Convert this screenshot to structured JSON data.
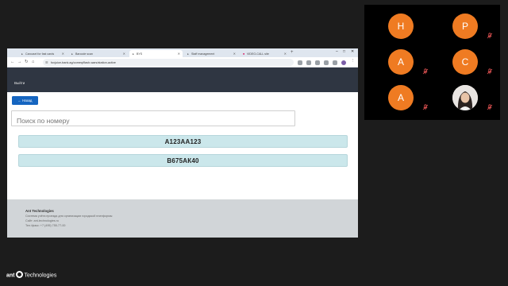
{
  "browser": {
    "tabs": [
      {
        "label": "Carousel for fast cards",
        "active": false
      },
      {
        "label": "Barcode scan",
        "active": false
      },
      {
        "label": "BYS",
        "active": true
      },
      {
        "label": "Staff management",
        "active": false
      },
      {
        "label": "VIDEO-CALL site",
        "active": false
      }
    ],
    "url": "foxjuice-bank.ag/comeq/flash-wars/station-active"
  },
  "app": {
    "exit_label": "Выйти",
    "back_label": "← Назад",
    "search_placeholder": "Поиск по номеру",
    "plates": [
      "А123АА123",
      "В675АК40"
    ],
    "footer": {
      "company": "Ant Technologies",
      "lines": [
        "Система учёта проезда для организации городской платформы",
        "Сайт: ant-technologies.ru",
        "Тел./факс: +7 (495) 755-77-00"
      ]
    }
  },
  "participants": [
    {
      "initial": "H",
      "muted": false
    },
    {
      "initial": "P",
      "muted": true
    },
    {
      "initial": "A",
      "muted": true
    },
    {
      "initial": "C",
      "muted": true
    },
    {
      "initial": "A",
      "muted": true
    },
    {
      "initial": "",
      "photo": true,
      "muted": true
    }
  ],
  "brand": {
    "name_ant": "ant",
    "name_rest": "Technologies"
  },
  "colors": {
    "avatar": "#ef7b22",
    "back_button": "#1565c0",
    "row_bg": "#cbe7eb",
    "header_bg": "#2f3642",
    "muted_icon": "#e05252"
  }
}
